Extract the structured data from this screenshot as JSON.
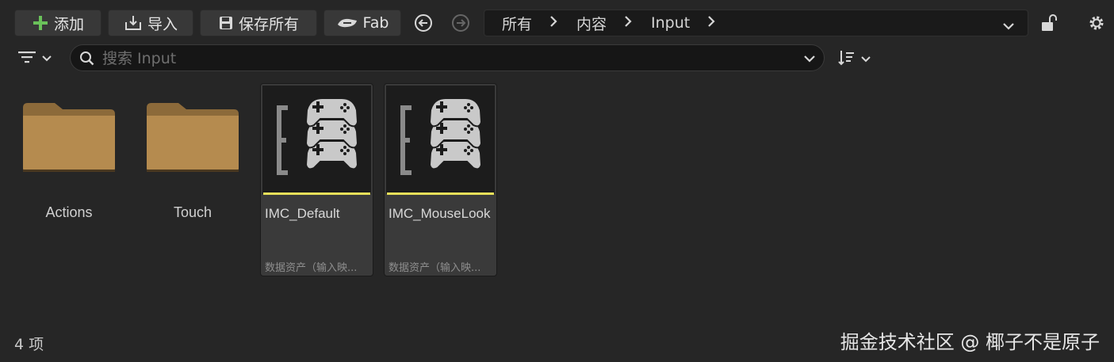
{
  "toolbar": {
    "add_label": "添加",
    "import_label": "导入",
    "save_all_label": "保存所有",
    "fab_label": "Fab"
  },
  "breadcrumb": [
    "所有",
    "内容",
    "Input"
  ],
  "search": {
    "placeholder": "搜索 Input",
    "value": ""
  },
  "items": {
    "folders": [
      {
        "name": "Actions"
      },
      {
        "name": "Touch"
      }
    ],
    "assets": [
      {
        "name": "IMC_Default",
        "type": "数据资产（输入映...",
        "icon": "gamepad-stack-icon"
      },
      {
        "name": "IMC_MouseLook",
        "type": "数据资产（输入映...",
        "icon": "gamepad-stack-icon"
      }
    ]
  },
  "status": {
    "item_count": "4 项"
  },
  "watermark": "掘金技术社区 @ 椰子不是原子",
  "colors": {
    "background": "#262626",
    "accent_add": "#6ac15a",
    "asset_bar": "#e8e05a",
    "folder": "#b58b4f"
  }
}
